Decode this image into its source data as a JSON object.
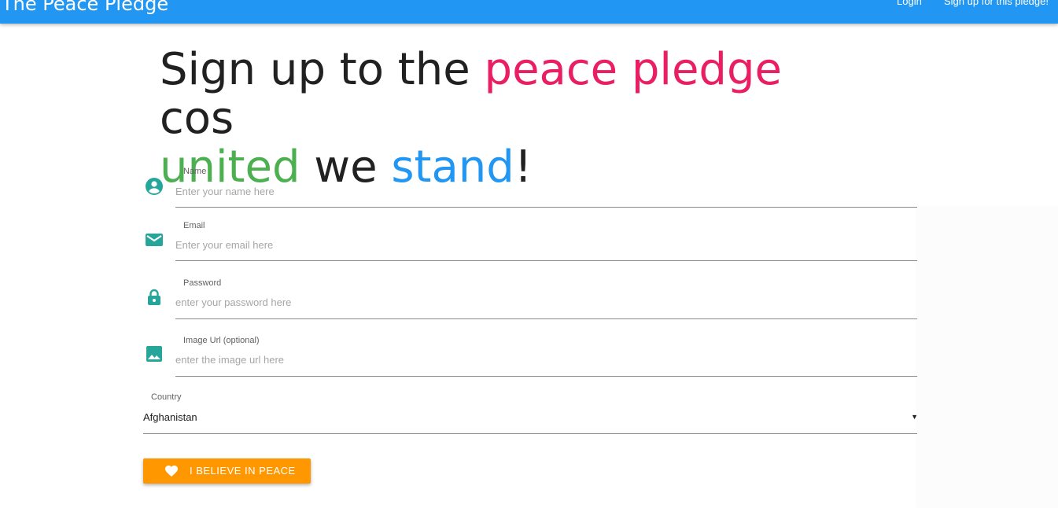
{
  "header": {
    "brand": "The Peace Pledge",
    "nav": {
      "login": "Login",
      "signup": "Sign up for this pledge!"
    }
  },
  "headline": {
    "part1": "Sign up to the ",
    "highlight1": "peace pledge",
    "part2": " cos",
    "highlight2": "united",
    "part3": " we ",
    "highlight3": "stand",
    "part4": "!"
  },
  "form": {
    "name": {
      "label": "Name",
      "placeholder": "Enter your name here",
      "value": ""
    },
    "email": {
      "label": "Email",
      "placeholder": "Enter your email here",
      "value": ""
    },
    "password": {
      "label": "Password",
      "placeholder": "enter your password here",
      "value": ""
    },
    "image_url": {
      "label": "Image Url (optional)",
      "placeholder": "enter the image url here",
      "value": ""
    },
    "country": {
      "label": "Country",
      "selected": "Afghanistan"
    },
    "submit_label": "I BELIEVE IN PEACE"
  },
  "icons": {
    "name": "account-circle-icon",
    "email": "email-icon",
    "password": "lock-icon",
    "image_url": "image-icon",
    "submit": "heart-icon",
    "country_caret": "caret-down-icon"
  },
  "colors": {
    "appbar": "#2196f3",
    "accent_pink": "#e91e63",
    "accent_green": "#4caf50",
    "accent_blue": "#2196f3",
    "icon_teal": "#26a69a",
    "button": "#ff9800"
  }
}
